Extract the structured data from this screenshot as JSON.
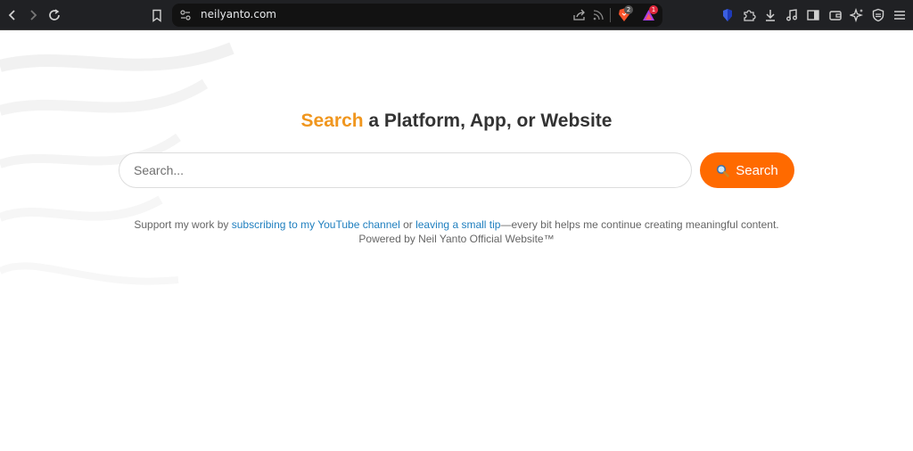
{
  "browser": {
    "url": "neilyanto.com",
    "brave_shield_count": "2",
    "rewards_count": "1"
  },
  "page": {
    "heading_accent": "Search",
    "heading_rest": " a Platform, App, or Website",
    "search": {
      "placeholder": "Search...",
      "button_label": "Search"
    },
    "support": {
      "prefix": "Support my work by ",
      "youtube_link": "subscribing to my YouTube channel",
      "middle": " or ",
      "tip_link": "leaving a small tip",
      "suffix": "—every bit helps me continue creating meaningful content.",
      "powered_by": "Powered by Neil Yanto Official Website™"
    }
  },
  "colors": {
    "accent": "#f0961e",
    "button": "#ff6a00",
    "link": "#1f7fbf",
    "chrome_bg": "#202124"
  }
}
